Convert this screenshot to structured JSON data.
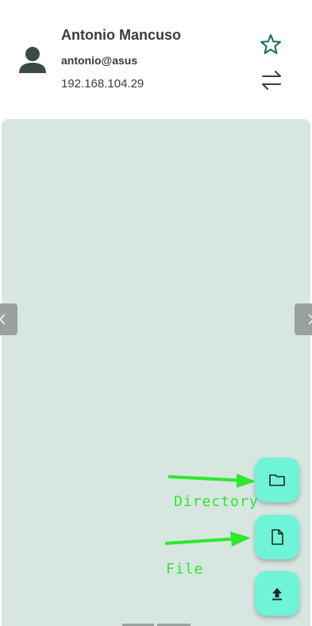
{
  "connection": {
    "name": "Antonio Mancuso",
    "user_host": "antonio@asus",
    "ip": "192.168.104.29"
  },
  "icons": {
    "avatar": "person-icon",
    "favorite": "star-outline-icon",
    "swap": "swap-arrows-icon",
    "prev": "chevron-left-icon",
    "next": "chevron-right-icon",
    "directory": "folder-icon",
    "file": "file-icon",
    "upload": "upload-icon"
  },
  "fab": {
    "directory_label": "Directory",
    "file_label": "File"
  },
  "colors": {
    "accent": "#6ff4d8",
    "panel": "#d8e6e1",
    "annotation": "#2ee82e",
    "star": "#0b6e5f"
  }
}
